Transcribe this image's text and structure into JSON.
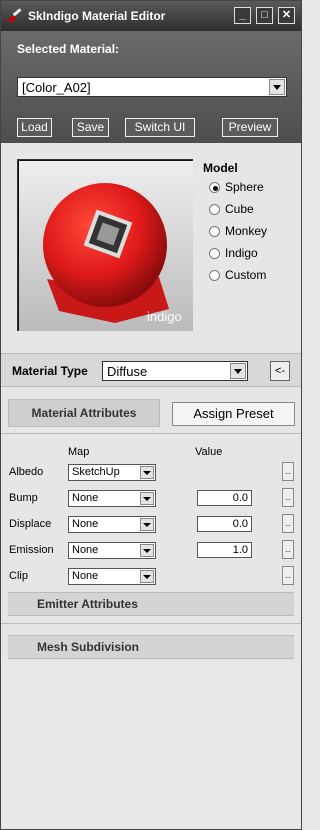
{
  "window": {
    "title": "SkIndigo Material Editor",
    "buttons": {
      "minimize": "_",
      "maximize": "□",
      "close": "✕"
    }
  },
  "header": {
    "selected_label": "Selected Material:",
    "selected_value": "[Color_A02]",
    "buttons": {
      "load": "Load",
      "save": "Save",
      "switch_ui": "Switch UI",
      "preview": "Preview"
    }
  },
  "preview": {
    "watermark": "indigo",
    "model_label": "Model",
    "models": [
      {
        "label": "Sphere",
        "checked": true
      },
      {
        "label": "Cube",
        "checked": false
      },
      {
        "label": "Monkey",
        "checked": false
      },
      {
        "label": "Indigo",
        "checked": false
      },
      {
        "label": "Custom",
        "checked": false
      }
    ],
    "colors": {
      "sphere": "#e01a1a",
      "background": "#dddddd"
    }
  },
  "material_type": {
    "label": "Material Type",
    "value": "Diffuse",
    "back_label": "<-"
  },
  "tabs": {
    "attributes": "Material Attributes",
    "assign_preset": "Assign Preset"
  },
  "attributes": {
    "headers": {
      "map": "Map",
      "value": "Value"
    },
    "rows": [
      {
        "label": "Albedo",
        "map": "SketchUp",
        "value": null,
        "more": ".."
      },
      {
        "label": "Bump",
        "map": "None",
        "value": "0.0",
        "more": ".."
      },
      {
        "label": "Displace",
        "map": "None",
        "value": "0.0",
        "more": ".."
      },
      {
        "label": "Emission",
        "map": "None",
        "value": "1.0",
        "more": ".."
      },
      {
        "label": "Clip",
        "map": "None",
        "value": null,
        "more": ".."
      }
    ]
  },
  "sections": {
    "emitter": "Emitter Attributes",
    "mesh": "Mesh Subdivision"
  }
}
